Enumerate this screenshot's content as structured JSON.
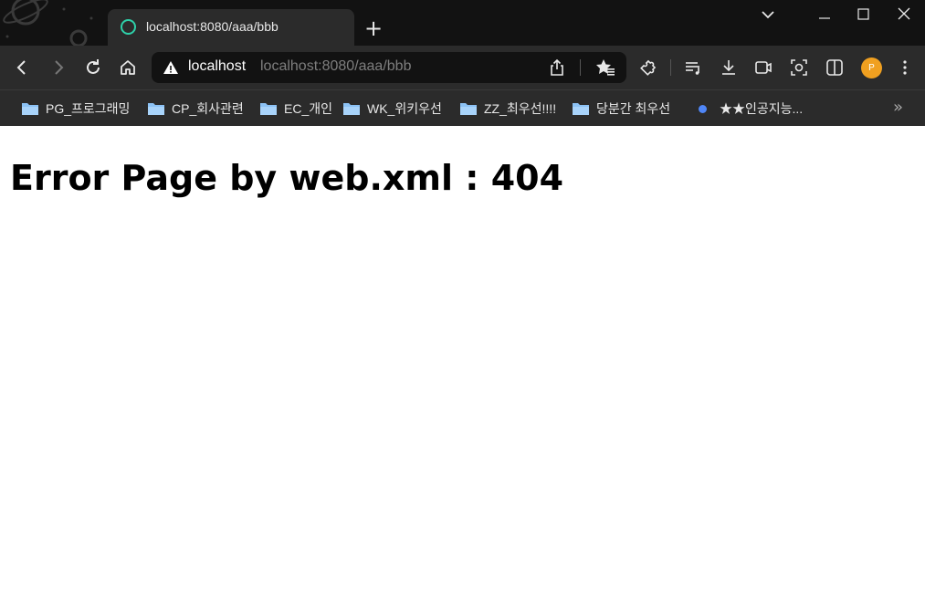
{
  "browser": {
    "tab": {
      "title": "localhost:8080/aaa/bbb",
      "favicon": "circle-icon",
      "favicon_color": "#2ed0a9"
    },
    "new_tab_label": "+",
    "address_bar": {
      "host": "localhost",
      "url": "localhost:8080/aaa/bbb",
      "security_icon": "warning-icon"
    },
    "profile_initial": "P",
    "profile_color": "#f0a020",
    "bookmarks": [
      {
        "label": "PG_프로그래밍",
        "icon": "folder-icon"
      },
      {
        "label": "CP_회사관련",
        "icon": "folder-icon"
      },
      {
        "label": "EC_개인",
        "icon": "folder-icon"
      },
      {
        "label": "WK_위키우선",
        "icon": "folder-icon"
      },
      {
        "label": "ZZ_최우선!!!!",
        "icon": "folder-icon"
      },
      {
        "label": "당분간 최우선",
        "icon": "folder-icon"
      },
      {
        "label": "★★인공지능...",
        "icon": "dot-icon"
      }
    ],
    "bookmarks_more": "»"
  },
  "page": {
    "heading": "Error Page by web.xml : 404"
  }
}
